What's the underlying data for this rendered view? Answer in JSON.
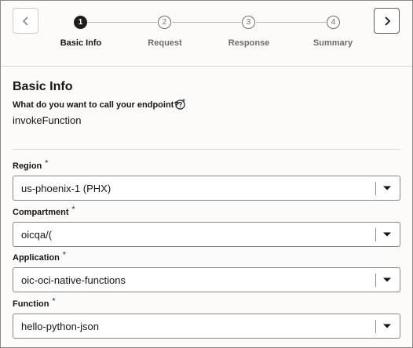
{
  "wizard": {
    "steps": [
      {
        "number": "1",
        "label": "Basic Info",
        "active": true
      },
      {
        "number": "2",
        "label": "Request",
        "active": false
      },
      {
        "number": "3",
        "label": "Response",
        "active": false
      },
      {
        "number": "4",
        "label": "Summary",
        "active": false
      }
    ]
  },
  "form": {
    "section_title": "Basic Info",
    "endpoint_name": {
      "label": "What do you want to call your endpoint?",
      "required_mark": "*",
      "value": "invokeFunction"
    },
    "region": {
      "label": "Region",
      "required_mark": "*",
      "value": "us-phoenix-1 (PHX)"
    },
    "compartment": {
      "label": "Compartment",
      "required_mark": "*",
      "value": "oicqa/("
    },
    "application": {
      "label": "Application",
      "required_mark": "*",
      "value": "oic-oci-native-functions"
    },
    "function": {
      "label": "Function",
      "required_mark": "*",
      "value": "hello-python-json"
    }
  },
  "colors": {
    "active_step": "#1f1c1a",
    "required_mark": "#2b6c9b",
    "border": "#8a8884"
  }
}
